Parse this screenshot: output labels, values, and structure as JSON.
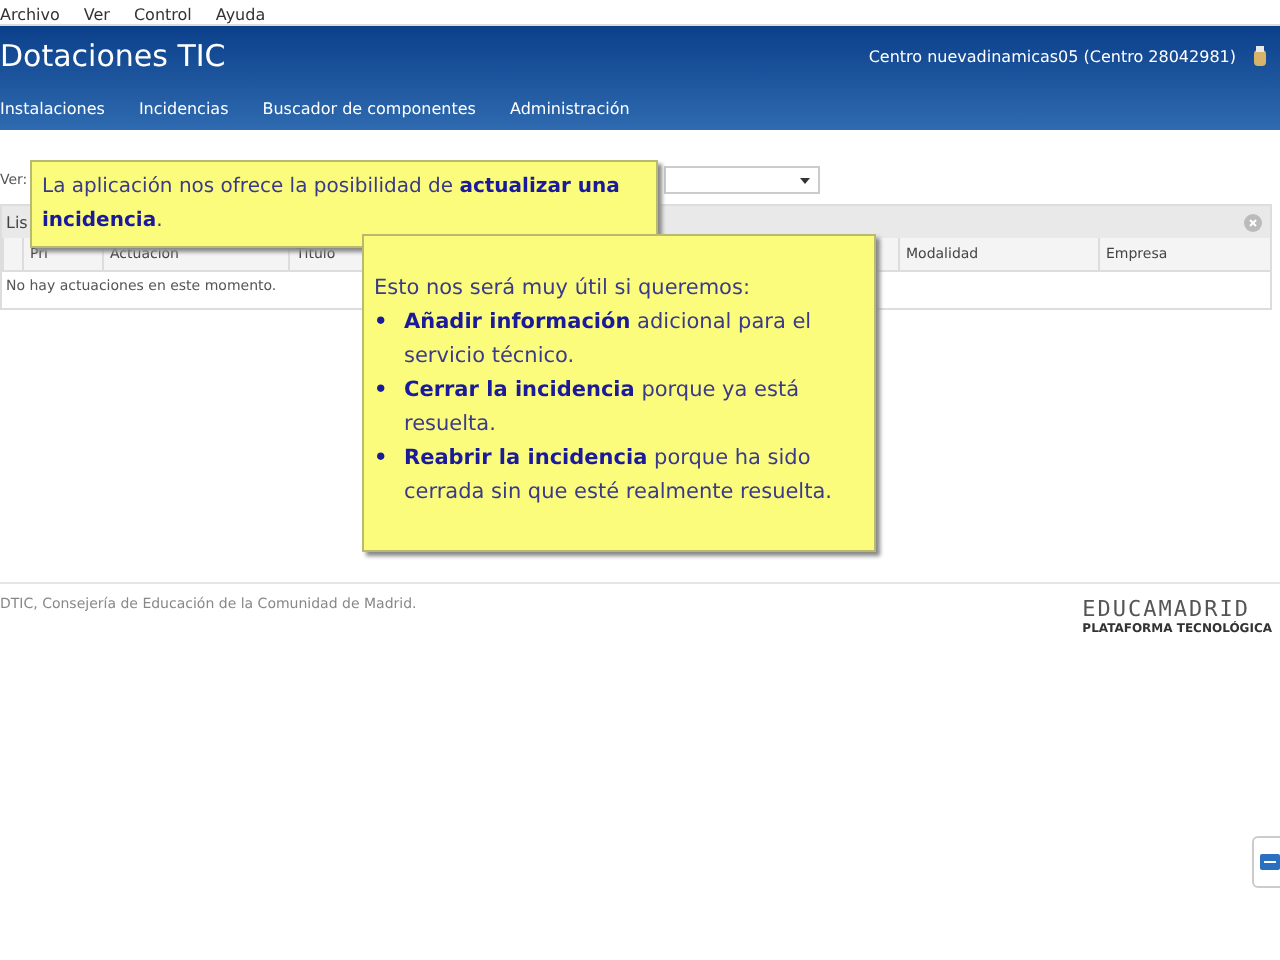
{
  "menu_bar": [
    "Archivo",
    "Ver",
    "Control",
    "Ayuda"
  ],
  "header": {
    "title": "Dotaciones TIC",
    "center": "Centro nuevadinamicas05 (Centro 28042981)"
  },
  "nav": [
    "Instalaciones",
    "Incidencias",
    "Buscador de componentes",
    "Administración"
  ],
  "filter": {
    "label": "Ver:"
  },
  "panel": {
    "title": "Lis",
    "columns": [
      "Pri",
      "Actuación",
      "Título",
      "Modalidad",
      "Empresa"
    ],
    "empty_message": "No hay actuaciones en este momento."
  },
  "footer": {
    "text": "DTIC, Consejería de Educación de la Comunidad de Madrid.",
    "logo_title": "EDUCAMADRID",
    "logo_subtitle": "PLATAFORMA TECNOLÓGICA"
  },
  "callouts": [
    {
      "text": "La aplicación nos ofrece la posibilidad de **actualizar una incidencia**."
    },
    {
      "text": "Esto nos será muy útil si queremos:",
      "marker": "•",
      "bullets": [
        "**Añadir información** adicional para el servicio técnico.",
        "**Cerrar la incidencia** porque ya está resuelta.",
        "**Reabrir la incidencia** porque ha sido cerrada sin que esté realmente resuelta."
      ]
    }
  ]
}
